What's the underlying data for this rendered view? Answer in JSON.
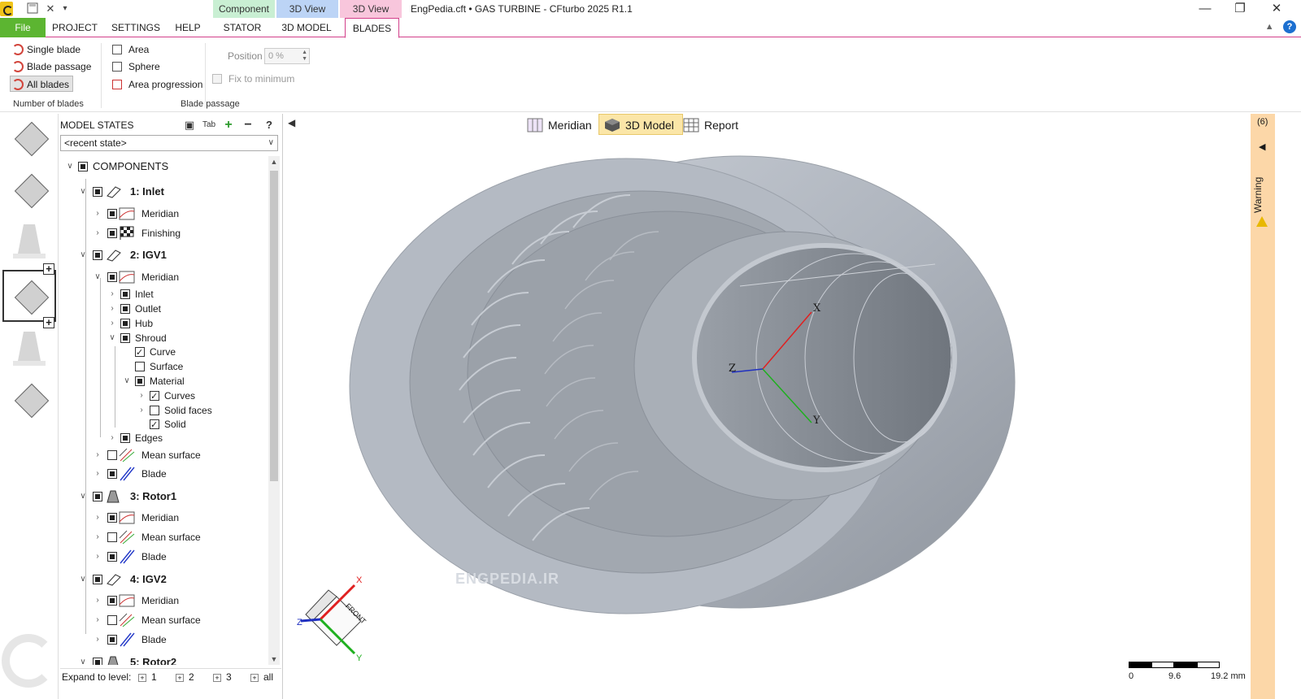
{
  "window": {
    "title": "EngPedia.cft • GAS TURBINE - CFturbo 2025 R1.1",
    "context_tabs": [
      "Component",
      "3D View",
      "3D View"
    ]
  },
  "ribbon_tabs": [
    "File",
    "PROJECT",
    "SETTINGS",
    "HELP",
    "STATOR",
    "3D MODEL",
    "BLADES"
  ],
  "ribbon": {
    "number_of_blades": {
      "label": "Number of blades",
      "buttons": [
        "Single blade",
        "Blade passage",
        "All blades"
      ]
    },
    "blade_passage": {
      "label": "Blade passage",
      "checks": [
        "Area",
        "Sphere",
        "Area progression"
      ],
      "position_label": "Position",
      "position_value": "0 %",
      "fix_label": "Fix to minimum"
    }
  },
  "model_states": {
    "title": "MODEL STATES",
    "tab_icon_label": "Tab",
    "selected_state": "<recent state>"
  },
  "tree": {
    "root": "COMPONENTS",
    "c1": "1: Inlet",
    "c1_meridian": "Meridian",
    "c1_finishing": "Finishing",
    "c2": "2: IGV1",
    "c2_meridian": "Meridian",
    "c2_inlet": "Inlet",
    "c2_outlet": "Outlet",
    "c2_hub": "Hub",
    "c2_shroud": "Shroud",
    "c2_curve": "Curve",
    "c2_surface": "Surface",
    "c2_material": "Material",
    "c2_curves": "Curves",
    "c2_solidfaces": "Solid faces",
    "c2_solid": "Solid",
    "c2_edges": "Edges",
    "c2_mean": "Mean surface",
    "c2_blade": "Blade",
    "c3": "3: Rotor1",
    "c3_meridian": "Meridian",
    "c3_mean": "Mean surface",
    "c3_blade": "Blade",
    "c4": "4: IGV2",
    "c4_meridian": "Meridian",
    "c4_mean": "Mean surface",
    "c4_blade": "Blade",
    "c5": "5: Rotor2"
  },
  "expand": {
    "label": "Expand to level:",
    "levels": [
      "1",
      "2",
      "3",
      "all"
    ]
  },
  "view_toggles": [
    "Meridian",
    "3D Model",
    "Report"
  ],
  "axes": {
    "x": "X",
    "y": "Y",
    "z": "Z"
  },
  "cube_label": "FRONT",
  "scale": {
    "ticks": [
      "0",
      "9.6",
      "19.2 mm"
    ]
  },
  "watermark": "ENGPEDIA.IR",
  "side_panel": {
    "count": "(6)",
    "warning": "Warning"
  },
  "colors": {
    "file_tab": "#5cb531",
    "active_tab_border": "#d23f8a",
    "warning_bar": "#fcd7a8",
    "axis_x": "#e02020",
    "axis_y": "#1eb01e",
    "axis_z": "#2030c0"
  }
}
